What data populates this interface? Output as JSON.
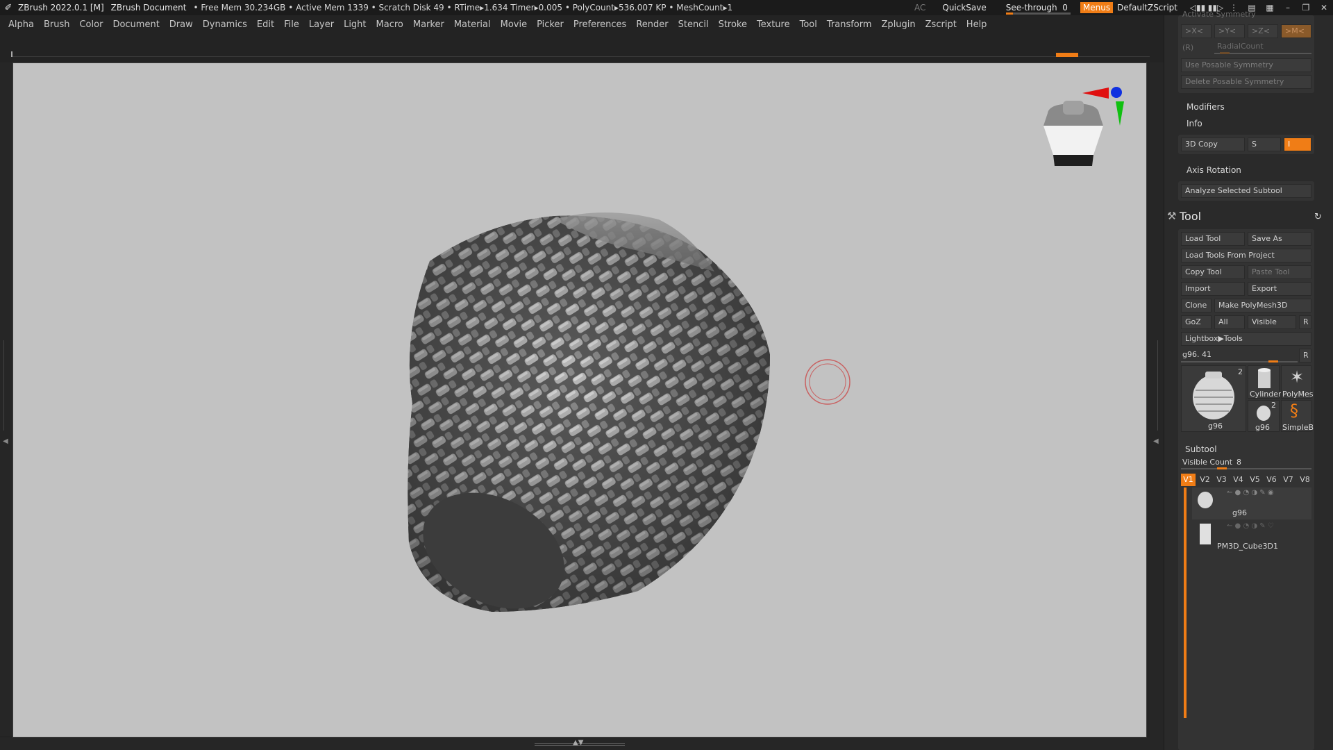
{
  "titlebar": {
    "app": "ZBrush 2022.0.1 [M]",
    "document": "ZBrush Document",
    "stats": "• Free Mem 30.234GB • Active Mem 1339 • Scratch Disk 49 •  RTime▸1.634 Timer▸0.005 • PolyCount▸536.007 KP • MeshCount▸1",
    "ac": "AC",
    "quicksave": "QuickSave",
    "see_through_label": "See-through",
    "see_through_value": "0",
    "menus": "Menus",
    "default_zscript": "DefaultZScript"
  },
  "menu": [
    "Alpha",
    "Brush",
    "Color",
    "Document",
    "Draw",
    "Dynamics",
    "Edit",
    "File",
    "Layer",
    "Light",
    "Macro",
    "Marker",
    "Material",
    "Movie",
    "Picker",
    "Preferences",
    "Render",
    "Stencil",
    "Stroke",
    "Texture",
    "Tool",
    "Transform",
    "Zplugin",
    "Zscript",
    "Help"
  ],
  "panel": {
    "activate_symmetry": "Activate Symmetry",
    "sym_x": ">X<",
    "sym_y": ">Y<",
    "sym_z": ">Z<",
    "sym_m": ">M<",
    "radial_r": "(R)",
    "radial_count": "RadialCount",
    "use_posable": "Use Posable Symmetry",
    "delete_posable": "Delete Posable Symmetry",
    "modifiers": "Modifiers",
    "info": "Info",
    "copy3d": "3D Copy",
    "copy3d_s": "S",
    "copy3d_i": "I",
    "axis_rotation": "Axis Rotation",
    "analyze": "Analyze Selected Subtool"
  },
  "tool": {
    "title": "Tool",
    "load_tool": "Load Tool",
    "save_as": "Save As",
    "load_from_project": "Load Tools From Project",
    "copy_tool": "Copy Tool",
    "paste_tool": "Paste Tool",
    "import": "Import",
    "export": "Export",
    "clone": "Clone",
    "make_polymesh": "Make PolyMesh3D",
    "goz": "GoZ",
    "all": "All",
    "visible": "Visible",
    "r": "R",
    "lightbox": "Lightbox▶Tools",
    "current_tool": "g96. 41",
    "current_r": "R",
    "thumbs": {
      "main_label": "g96",
      "main_count": "2",
      "cylinder": "Cylinder",
      "polymesh": "PolyMes",
      "g96_small": "g96",
      "g96_small_count": "2",
      "simpleb": "SimpleB"
    }
  },
  "subtool": {
    "title": "Subtool",
    "visible_count_label": "Visible Count",
    "visible_count_value": "8",
    "tabs": [
      "V1",
      "V2",
      "V3",
      "V4",
      "V5",
      "V6",
      "V7",
      "V8"
    ],
    "items": [
      {
        "name": "g96"
      },
      {
        "name": "PM3D_Cube3D1"
      }
    ]
  },
  "colors": {
    "accent": "#f07d16",
    "canvas": "#c2c2c2",
    "panel": "#2a2a2a"
  }
}
